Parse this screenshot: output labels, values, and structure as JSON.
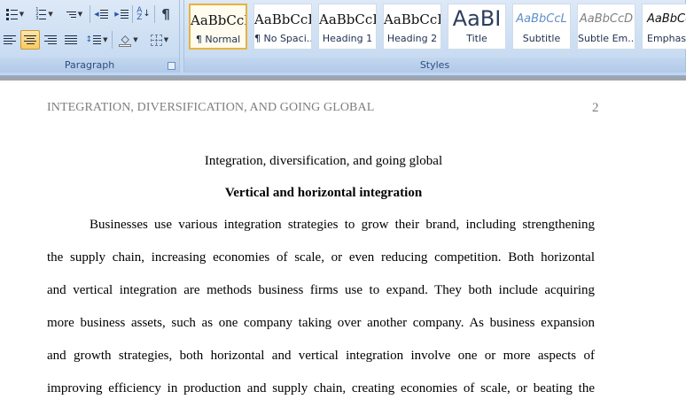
{
  "ribbon": {
    "paragraph_group": {
      "label": "Paragraph",
      "buttons": {
        "bullets": "bullets-icon",
        "numbering": "numbering-icon",
        "multilevel": "multilevel-list-icon",
        "decrease_indent": "decrease-indent-icon",
        "increase_indent": "increase-indent-icon",
        "sort": "sort-icon",
        "show_marks": "¶",
        "align_left": "align-left-icon",
        "align_center": "align-center-icon",
        "align_right": "align-right-icon",
        "justify": "justify-icon",
        "line_spacing": "line-spacing-icon",
        "shading": "shading-icon",
        "borders": "borders-icon"
      }
    },
    "styles_group": {
      "label": "Styles",
      "styles": [
        {
          "sample": "AaBbCcI",
          "name": "¶ Normal"
        },
        {
          "sample": "AaBbCcI",
          "name": "¶ No Spaci..."
        },
        {
          "sample": "AaBbCcI",
          "name": "Heading 1"
        },
        {
          "sample": "AaBbCcI",
          "name": "Heading 2"
        },
        {
          "sample": "AaBI",
          "name": "Title"
        },
        {
          "sample": "AaBbCcL",
          "name": "Subtitle"
        },
        {
          "sample": "AaBbCcD",
          "name": "Subtle Em..."
        },
        {
          "sample": "AaBbCcI",
          "name": "Emphasis"
        }
      ]
    },
    "colors": {
      "accent": "#e9b23c",
      "label_text": "#2c4d80"
    }
  },
  "document": {
    "running_head": "INTEGRATION, DIVERSIFICATION, AND GOING GLOBAL",
    "page_number": "2",
    "title": "Integration, diversification, and going global",
    "heading": "Vertical and horizontal integration",
    "paragraph_lines": [
      "Businesses use various integration strategies to grow their brand, including strengthening",
      "the supply chain, increasing economies of scale, or even reducing competition. Both horizontal",
      "and vertical integration are methods business firms use to expand. They both include acquiring",
      "more business assets, such as one company taking over another company. As business expansion",
      "and growth strategies, both horizontal and vertical integration involve one or more aspects of",
      "improving efficiency in production and supply chain, creating economies of scale, or beating the"
    ]
  }
}
